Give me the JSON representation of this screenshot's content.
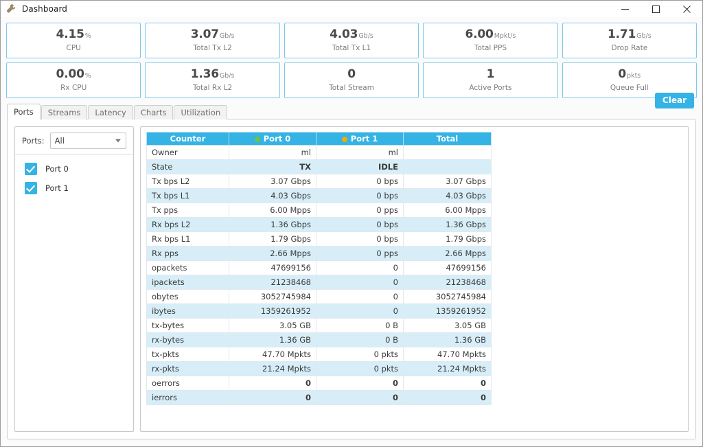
{
  "window": {
    "title": "Dashboard",
    "icon": "wrench-icon",
    "controls": {
      "minimize": "minimize-icon",
      "maximize": "maximize-icon",
      "close": "close-icon"
    }
  },
  "colors": {
    "accent": "#34b3e4",
    "card_border": "#7ec7ea",
    "row_alt": "#d7eef8",
    "state_text": "#f0ad00",
    "error_ok": "#1faa1f",
    "port0_dot": "#6ec53f",
    "port1_dot": "#f0ad00"
  },
  "stats": {
    "row1": [
      {
        "value": "4.15",
        "unit": "%",
        "label": "CPU"
      },
      {
        "value": "3.07",
        "unit": "Gb/s",
        "label": "Total Tx L2"
      },
      {
        "value": "4.03",
        "unit": "Gb/s",
        "label": "Total Tx L1"
      },
      {
        "value": "6.00",
        "unit": "Mpkt/s",
        "label": "Total PPS"
      },
      {
        "value": "1.71",
        "unit": "Gb/s",
        "label": "Drop Rate"
      }
    ],
    "row2": [
      {
        "value": "0.00",
        "unit": "%",
        "label": "Rx CPU"
      },
      {
        "value": "1.36",
        "unit": "Gb/s",
        "label": "Total Rx L2"
      },
      {
        "value": "0",
        "unit": "",
        "label": "Total Stream"
      },
      {
        "value": "1",
        "unit": "",
        "label": "Active Ports"
      },
      {
        "value": "0",
        "unit": "pkts",
        "label": "Queue Full"
      }
    ]
  },
  "tabs": [
    {
      "label": "Ports",
      "active": true
    },
    {
      "label": "Streams",
      "active": false
    },
    {
      "label": "Latency",
      "active": false
    },
    {
      "label": "Charts",
      "active": false
    },
    {
      "label": "Utilization",
      "active": false
    }
  ],
  "clear_button": {
    "label": "Clear"
  },
  "sidebar": {
    "selector_label": "Ports:",
    "selector_value": "All",
    "ports": [
      {
        "label": "Port 0",
        "checked": true
      },
      {
        "label": "Port 1",
        "checked": true
      }
    ]
  },
  "table": {
    "headers": [
      {
        "label": "Counter",
        "dot": null
      },
      {
        "label": "Port 0",
        "dot": "#6ec53f"
      },
      {
        "label": "Port 1",
        "dot": "#f0ad00"
      },
      {
        "label": "Total",
        "dot": null
      }
    ],
    "rows": [
      {
        "name": "Owner",
        "port0": "ml",
        "port1": "ml",
        "total": "",
        "style": "plain"
      },
      {
        "name": "State",
        "port0": "TX",
        "port1": "IDLE",
        "total": "",
        "style": "state"
      },
      {
        "name": "Tx bps L2",
        "port0": "3.07 Gbps",
        "port1": "0 bps",
        "total": "3.07 Gbps",
        "style": "plain"
      },
      {
        "name": "Tx bps L1",
        "port0": "4.03 Gbps",
        "port1": "0 bps",
        "total": "4.03 Gbps",
        "style": "plain"
      },
      {
        "name": "Tx pps",
        "port0": "6.00 Mpps",
        "port1": "0 pps",
        "total": "6.00 Mpps",
        "style": "plain"
      },
      {
        "name": "Rx bps L2",
        "port0": "1.36 Gbps",
        "port1": "0 bps",
        "total": "1.36 Gbps",
        "style": "plain"
      },
      {
        "name": "Rx bps L1",
        "port0": "1.79 Gbps",
        "port1": "0 bps",
        "total": "1.79 Gbps",
        "style": "plain"
      },
      {
        "name": "Rx pps",
        "port0": "2.66 Mpps",
        "port1": "0 pps",
        "total": "2.66 Mpps",
        "style": "plain"
      },
      {
        "name": "opackets",
        "port0": "47699156",
        "port1": "0",
        "total": "47699156",
        "style": "plain"
      },
      {
        "name": "ipackets",
        "port0": "21238468",
        "port1": "0",
        "total": "21238468",
        "style": "plain"
      },
      {
        "name": "obytes",
        "port0": "3052745984",
        "port1": "0",
        "total": "3052745984",
        "style": "plain"
      },
      {
        "name": "ibytes",
        "port0": "1359261952",
        "port1": "0",
        "total": "1359261952",
        "style": "plain"
      },
      {
        "name": "tx-bytes",
        "port0": "3.05 GB",
        "port1": "0 B",
        "total": "3.05 GB",
        "style": "plain"
      },
      {
        "name": "rx-bytes",
        "port0": "1.36 GB",
        "port1": "0 B",
        "total": "1.36 GB",
        "style": "plain"
      },
      {
        "name": "tx-pkts",
        "port0": "47.70 Mpkts",
        "port1": "0 pkts",
        "total": "47.70 Mpkts",
        "style": "plain"
      },
      {
        "name": "rx-pkts",
        "port0": "21.24 Mpkts",
        "port1": "0 pkts",
        "total": "21.24 Mpkts",
        "style": "plain"
      },
      {
        "name": "oerrors",
        "port0": "0",
        "port1": "0",
        "total": "0",
        "style": "error"
      },
      {
        "name": "ierrors",
        "port0": "0",
        "port1": "0",
        "total": "0",
        "style": "error"
      }
    ]
  }
}
